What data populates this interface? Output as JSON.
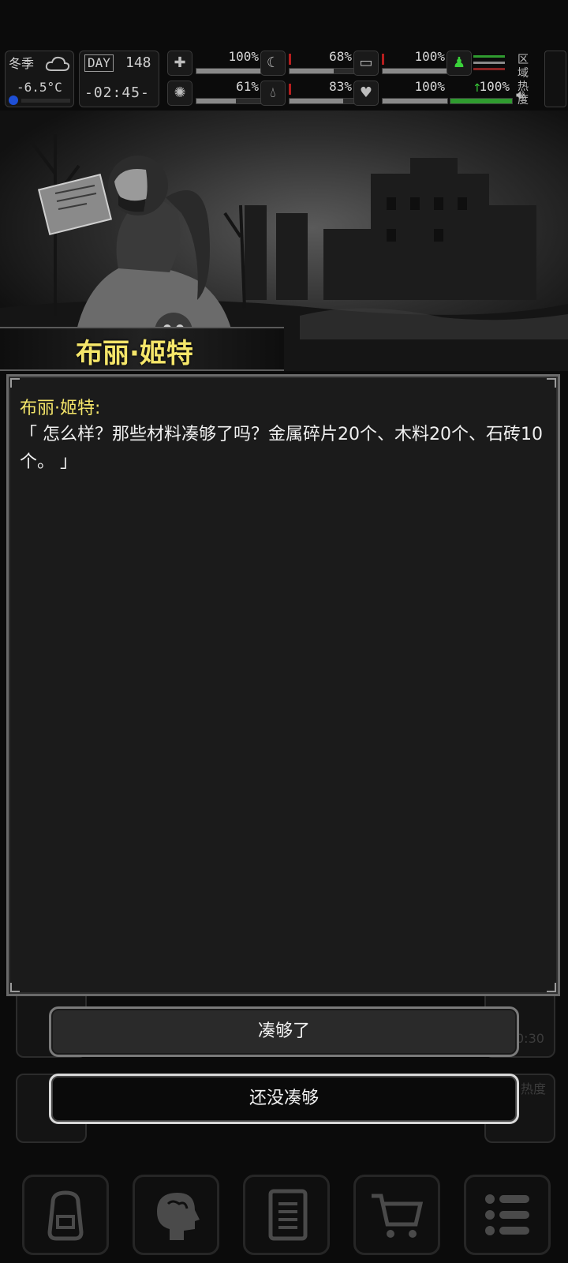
{
  "status": {
    "season": "冬季",
    "weather_icon": "cloud-icon",
    "temperature": "-6.5°C",
    "day_label": "DAY",
    "day_number": "148",
    "clock": "-02:45-",
    "region_label": "区域热度",
    "stats": [
      {
        "name": "health",
        "icon": "medkit-icon",
        "value": "100%",
        "level": 1.0
      },
      {
        "name": "hunger",
        "icon": "stomach-icon",
        "value": "68%",
        "level": 0.68
      },
      {
        "name": "stamina",
        "icon": "pill-icon",
        "value": "100%",
        "level": 1.0
      },
      {
        "name": "mental",
        "icon": "brain-icon",
        "value": "61%",
        "level": 0.61
      },
      {
        "name": "thirst",
        "icon": "water-drop-icon",
        "value": "83%",
        "level": 0.83
      },
      {
        "name": "mood",
        "icon": "heart-icon",
        "value": "100%",
        "level": 1.0
      },
      {
        "name": "warmth",
        "icon": "arrow-up-icon",
        "value": "100%",
        "level": 1.0
      }
    ]
  },
  "scene": {
    "character_name": "布丽·姬特"
  },
  "dialog": {
    "speaker": "布丽·姬特:",
    "text": "「 怎么样？那些材料凑够了吗？金属碎片20个、木料20个、石砖10个。 」"
  },
  "choices": {
    "option1": "凑够了",
    "option2": "还没凑够"
  },
  "background_panels": {
    "timer_fragment": "0:30",
    "heat_fragment": "热度"
  },
  "nav": {
    "items": [
      "backpack-icon",
      "brain-head-icon",
      "journal-icon",
      "cart-icon",
      "menu-icon"
    ]
  }
}
